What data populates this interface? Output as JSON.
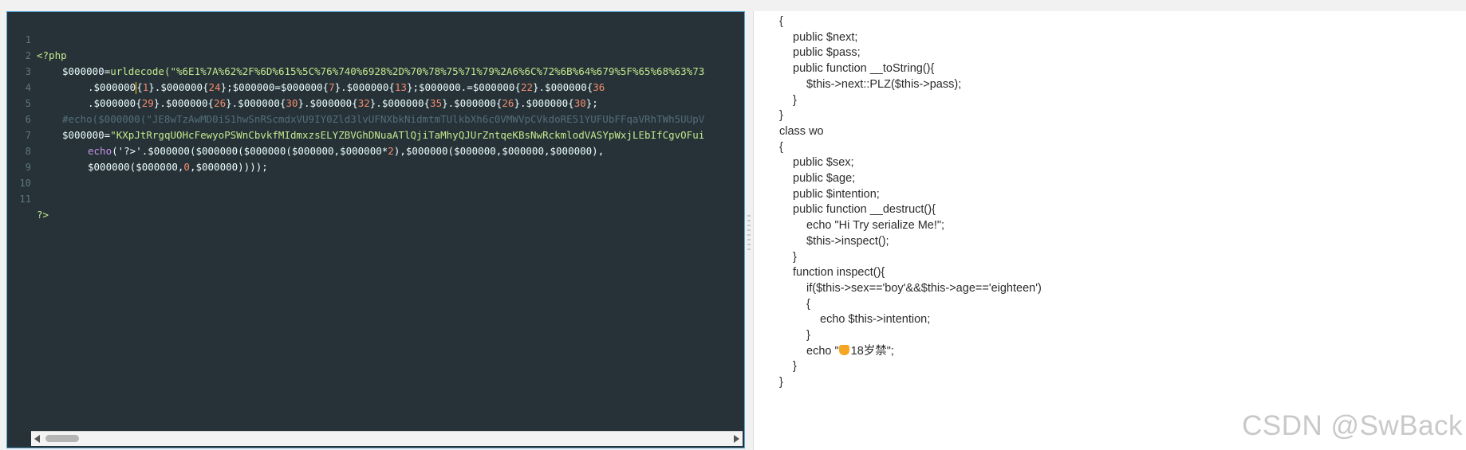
{
  "editor": {
    "line_numbers": [
      "1",
      "2",
      "3",
      "4",
      "5",
      "6",
      "7",
      "8",
      "9",
      "10",
      "11"
    ],
    "line1": "<?php",
    "line2": {
      "var": "$000000",
      "eq": "=",
      "fn": "urldecode",
      "str": "(\"%6E1%7A%62%2F%6D%615%5C%76%740%6928%2D%70%78%75%71%79%2A6%6C%72%6B%64%679%5F%65%68%63%73"
    },
    "line3": [
      {
        "t": ".$000000",
        "k": "var"
      },
      {
        "t": "{",
        "k": "var"
      },
      {
        "t": "1",
        "k": "num"
      },
      {
        "t": "}.$000000{",
        "k": "var"
      },
      {
        "t": "24",
        "k": "num"
      },
      {
        "t": "};$000000=$000000{",
        "k": "var"
      },
      {
        "t": "7",
        "k": "num"
      },
      {
        "t": "}.$000000{",
        "k": "var"
      },
      {
        "t": "13",
        "k": "num"
      },
      {
        "t": "};$000000.=$000000{",
        "k": "var"
      },
      {
        "t": "22",
        "k": "num"
      },
      {
        "t": "}.$000000{",
        "k": "var"
      },
      {
        "t": "36",
        "k": "num"
      }
    ],
    "line4": [
      {
        "t": ".$000000{",
        "k": "var"
      },
      {
        "t": "29",
        "k": "num"
      },
      {
        "t": "}.$000000{",
        "k": "var"
      },
      {
        "t": "26",
        "k": "num"
      },
      {
        "t": "}.$000000{",
        "k": "var"
      },
      {
        "t": "30",
        "k": "num"
      },
      {
        "t": "}.$000000{",
        "k": "var"
      },
      {
        "t": "32",
        "k": "num"
      },
      {
        "t": "}.$000000{",
        "k": "var"
      },
      {
        "t": "35",
        "k": "num"
      },
      {
        "t": "}.$000000{",
        "k": "var"
      },
      {
        "t": "26",
        "k": "num"
      },
      {
        "t": "}.$000000{",
        "k": "var"
      },
      {
        "t": "30",
        "k": "num"
      },
      {
        "t": "};",
        "k": "var"
      }
    ],
    "line5": "#echo($000000(\"JE8wTzAwMD0iS1hwSnRScmdxVU9IY0Zld3lvUFNXbkNidmtmTUlkbXh6c0VMWVpCVkdoRE51YUFUbFFqaVRhTWh5UUpV",
    "line6": {
      "var": "$000000=",
      "str": "\"KXpJtRrgqUOHcFewyoPSWnCbvkfMIdmxzsELYZBVGhDNuaATlQjiTaMhyQJUrZntqeKBsNwRckmlodVASYpWxjLEbIfCgvOFui"
    },
    "line7": {
      "kw": "echo",
      "rest1": "('?>'.$000000($000000($000000($000000,$000000*",
      "num": "2",
      "rest2": "),$000000($000000,$000000,$000000),"
    },
    "line8": {
      "rest1": "$000000($000000,",
      "num": "0",
      "rest2": ",$000000))));"
    },
    "line11": "?>"
  },
  "preview": {
    "lines": [
      {
        "indent": 0,
        "text": "{"
      },
      {
        "indent": 1,
        "text": "public $next;"
      },
      {
        "indent": 1,
        "text": "public $pass;"
      },
      {
        "indent": 1,
        "text": "public function __toString(){"
      },
      {
        "indent": 2,
        "text": "$this->next::PLZ($this->pass);"
      },
      {
        "indent": 1,
        "text": "}"
      },
      {
        "indent": 0,
        "text": "}"
      },
      {
        "indent": 0,
        "text": "class wo"
      },
      {
        "indent": 0,
        "text": "{"
      },
      {
        "indent": 1,
        "text": "public $sex;"
      },
      {
        "indent": 1,
        "text": "public $age;"
      },
      {
        "indent": 1,
        "text": "public $intention;"
      },
      {
        "indent": 1,
        "text": "public function __destruct(){"
      },
      {
        "indent": 2,
        "text": "echo \"Hi Try serialize Me!\";"
      },
      {
        "indent": 2,
        "text": "$this->inspect();"
      },
      {
        "indent": 1,
        "text": "}"
      },
      {
        "indent": 1,
        "text": "function inspect(){"
      },
      {
        "indent": 2,
        "text": "if($this->sex=='boy'&&$this->age=='eighteen')"
      },
      {
        "indent": 2,
        "text": "{"
      },
      {
        "indent": 3,
        "text": "echo $this->intention;"
      },
      {
        "indent": 2,
        "text": "}"
      },
      {
        "indent": 2,
        "text": "echo \"",
        "emoji": "person-emoji-icon",
        "tail": "18岁禁\";"
      },
      {
        "indent": 1,
        "text": "}"
      },
      {
        "indent": 0,
        "text": "}"
      }
    ]
  },
  "watermark": "CSDN @SwBack",
  "colors": {
    "editor_bg": "#263238",
    "string": "#c3e88d",
    "number": "#f78c6c",
    "comment": "#546e7a",
    "keyword": "#c792ea"
  }
}
